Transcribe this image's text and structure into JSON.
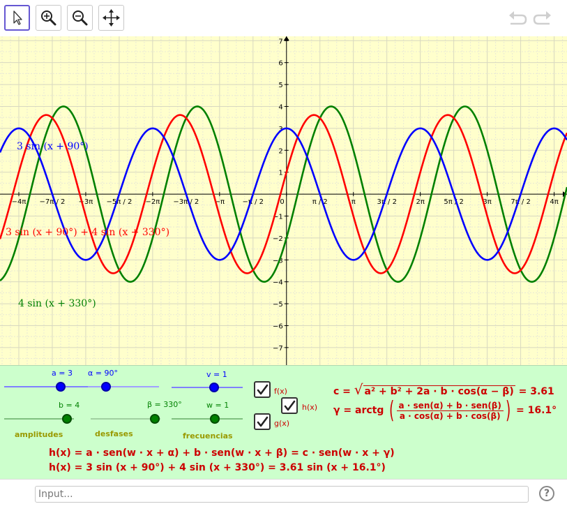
{
  "toolbar": {
    "tools": [
      {
        "name": "move-tool",
        "icon": "arrow-cursor-icon"
      },
      {
        "name": "zoom-in-tool",
        "icon": "zoom-in-icon"
      },
      {
        "name": "zoom-out-tool",
        "icon": "zoom-out-icon"
      },
      {
        "name": "pan-tool",
        "icon": "move-arrows-icon"
      }
    ],
    "undo_icon": "undo-icon",
    "redo_icon": "redo-icon"
  },
  "graph": {
    "x_ticks": [
      "−4π",
      "−7π / 2",
      "−3π",
      "−5π / 2",
      "−2π",
      "−3π / 2",
      "−π",
      "−π / 2",
      "0",
      "π / 2",
      "π",
      "3π / 2",
      "2π",
      "5π / 2",
      "3π",
      "7π / 2",
      "4π"
    ],
    "y_ticks": [
      "7",
      "6",
      "5",
      "4",
      "3",
      "2",
      "1",
      "−1",
      "−2",
      "−3",
      "−4",
      "−5",
      "−6",
      "−7"
    ],
    "labels": {
      "f": "3  sin (x + 90°)",
      "h": "3  sin (x + 90°) + 4  sin (x + 330°)",
      "g": "4  sin (x + 330°)"
    },
    "colors": {
      "f": "#0000ff",
      "h": "#ff0000",
      "g": "#008000"
    }
  },
  "chart_data": {
    "type": "line",
    "xlim": [
      -13.45,
      13.17
    ],
    "ylim": [
      -7.8,
      7.2
    ],
    "series": [
      {
        "name": "3  sin (x + 90°)",
        "amplitude": 3,
        "frequency": 1,
        "phase_deg": 90,
        "color": "#0000ff"
      },
      {
        "name": "3  sin (x + 90°) + 4  sin (x + 330°)",
        "amplitude": 3.61,
        "frequency": 1,
        "phase_deg": 16.1,
        "color": "#ff0000"
      },
      {
        "name": "4  sin (x + 330°)",
        "amplitude": 4,
        "frequency": 1,
        "phase_deg": 330,
        "color": "#008000"
      }
    ]
  },
  "sliders": {
    "a": {
      "label": "a = 3",
      "value": 3,
      "min": 0,
      "max": 5,
      "color": "#0000ff"
    },
    "alpha": {
      "label": "α = 90°",
      "value": 90,
      "min": 0,
      "max": 360,
      "color": "#0000ff"
    },
    "v": {
      "label": "v = 1",
      "value": 1,
      "min": -2,
      "max": 2,
      "color": "#0000ff"
    },
    "b": {
      "label": "b = 4",
      "value": 4,
      "min": 0,
      "max": 5,
      "color": "#008000"
    },
    "beta": {
      "label": "β = 330°",
      "value": 330,
      "min": 0,
      "max": 360,
      "color": "#008000"
    },
    "w": {
      "label": "w = 1",
      "value": 1,
      "min": -2,
      "max": 2,
      "color": "#008000"
    }
  },
  "groups": {
    "amplitudes": "amplitudes",
    "desfases": "desfases",
    "frecuencias": "frecuencias"
  },
  "checkboxes": {
    "f": {
      "label": "f(x)",
      "checked": true
    },
    "h": {
      "label": "h(x)",
      "checked": true
    },
    "g": {
      "label": "g(x)",
      "checked": true
    }
  },
  "formulas": {
    "c_lhs": "c =",
    "c_radicand": "a² + b² + 2a · b · cos(α − β)",
    "c_rhs": "= 3.61",
    "gamma_lhs": "γ = arctg",
    "gamma_num": "a · sen(α) + b · sen(β)",
    "gamma_den": "a · cos(α) + b · cos(β)",
    "gamma_rhs": "= 16.1°",
    "h_general": "h(x) = a · sen(w · x + α) + b · sen(w · x + β) = c · sen(w · x + γ)",
    "h_numeric": "h(x) = 3  sin (x + 90°) + 4  sin (x + 330°) = 3.61  sin (x + 16.1°)"
  },
  "input": {
    "placeholder": "Input..."
  },
  "help_label": "?"
}
